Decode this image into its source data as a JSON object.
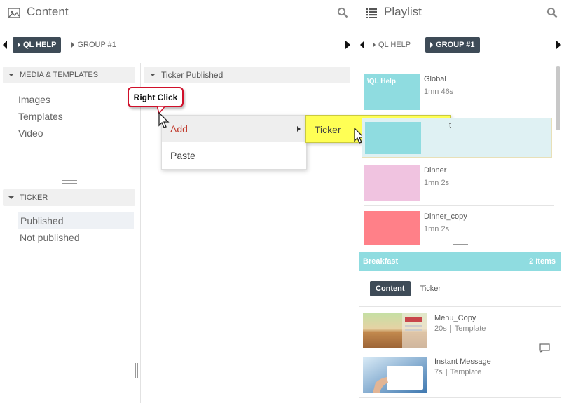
{
  "left_panel": {
    "title": "Content",
    "tabs": [
      {
        "label": "QL HELP",
        "active": true
      },
      {
        "label": "GROUP #1",
        "active": false
      }
    ],
    "sidebar": {
      "media_section": "MEDIA & TEMPLATES",
      "media_items": [
        "Images",
        "Templates",
        "Video"
      ],
      "ticker_section": "TICKER",
      "ticker_items": [
        "Published",
        "Not published"
      ]
    },
    "content_section": "Ticker Published"
  },
  "context_menu": {
    "items": [
      "Add",
      "Paste"
    ],
    "submenu_item": "Ticker"
  },
  "callout": {
    "label": "Right Click"
  },
  "right_panel": {
    "title": "Playlist",
    "tabs": [
      {
        "label": "QL HELP",
        "active": false
      },
      {
        "label": "GROUP #1",
        "active": true
      }
    ],
    "playlists": [
      {
        "thumb_text": "\\QL Help",
        "name": "Global",
        "duration": "1mn 46s",
        "color": "#8fdce0"
      },
      {
        "thumb_text": "",
        "name": "t",
        "duration": "",
        "color": "#8fdce0"
      },
      {
        "thumb_text": "",
        "name": "Dinner",
        "duration": "1mn 2s",
        "color": "#f0c3e0"
      },
      {
        "thumb_text": "",
        "name": "Dinner_copy",
        "duration": "1mn 2s",
        "color": "#ff8088"
      }
    ],
    "breakfast": {
      "label": "Breakfast",
      "count": "2 Items",
      "subtabs": [
        {
          "label": "Content",
          "active": true
        },
        {
          "label": "Ticker",
          "active": false
        }
      ],
      "items": [
        {
          "name": "Menu_Copy",
          "duration": "20s",
          "type": "Template"
        },
        {
          "name": "Instant Message",
          "duration": "7s",
          "type": "Template"
        }
      ]
    }
  },
  "colors": {
    "accent_dark": "#3e4b57",
    "callout_border": "#d0102a",
    "submenu_highlight": "#ffff55",
    "breakfast_bar": "#8fdce0"
  }
}
